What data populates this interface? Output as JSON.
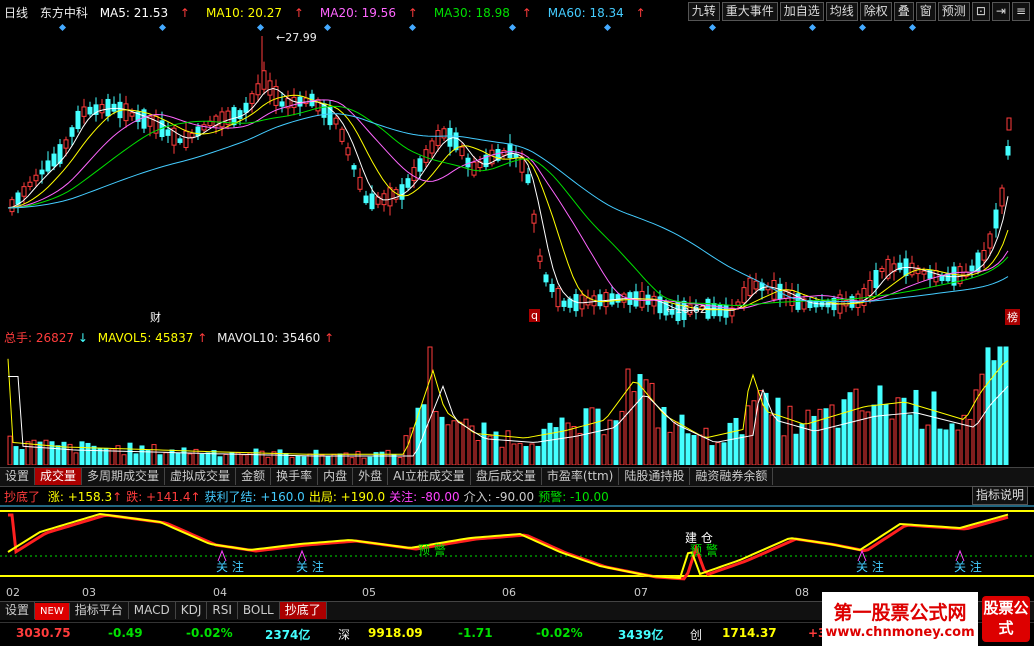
{
  "header": {
    "period": "日线",
    "stock": "东方中科",
    "ma": [
      {
        "label": "MA5: 21.53",
        "arrow": "↑",
        "color": "#ffffff"
      },
      {
        "label": "MA10: 20.27",
        "arrow": "↑",
        "color": "#ffff00"
      },
      {
        "label": "MA20: 19.56",
        "arrow": "↑",
        "color": "#ff66ff"
      },
      {
        "label": "MA30: 18.98",
        "arrow": "↑",
        "color": "#00e000"
      },
      {
        "label": "MA60: 18.34",
        "arrow": "↑",
        "color": "#44ccff"
      }
    ],
    "buttons": [
      "九转",
      "重大事件",
      "加自选",
      "均线",
      "除权",
      "叠",
      "窗",
      "预测"
    ]
  },
  "price_chart": {
    "high_label": "27.99",
    "low_label": "16.62",
    "markers": [
      "财",
      "q",
      "榜"
    ]
  },
  "volume": {
    "total_label": "总手: 26827",
    "total_arrow": "↓",
    "mavol5": "MAVOL5: 45837",
    "mavol5_arrow": "↑",
    "mavol10": "MAVOL10: 35460",
    "mavol10_arrow": "↑"
  },
  "volume_tabs": [
    "设置",
    "成交量",
    "多周期成交量",
    "虚拟成交量",
    "金额",
    "换手率",
    "内盘",
    "外盘",
    "AI立桩成交量",
    "盘后成交量",
    "市盈率(ttm)",
    "陆股通持股",
    "融资融券余额"
  ],
  "indicator": {
    "name": "抄底了",
    "params": [
      {
        "label": "涨: +158.3",
        "arrow": "↑",
        "color": "#ffff00"
      },
      {
        "label": "跌: +141.4",
        "arrow": "↑",
        "color": "#ff3c3c"
      },
      {
        "label": "获利了结: +160.0",
        "arrow": "",
        "color": "#44ccff"
      },
      {
        "label": "出局: +190.0",
        "arrow": "",
        "color": "#ffff00"
      },
      {
        "label": "关注: -80.00",
        "arrow": "",
        "color": "#ff44ff"
      },
      {
        "label": "介入: -90.00",
        "arrow": "",
        "color": "#cccccc"
      },
      {
        "label": "预警: -10.00",
        "arrow": "",
        "color": "#00e000"
      }
    ],
    "help_button": "指标说明",
    "annotations": {
      "guanzhu": "关 注",
      "yujing": "预 警",
      "jiancang": "建 仓"
    }
  },
  "x_axis": [
    "02",
    "03",
    "04",
    "05",
    "06",
    "07",
    "08"
  ],
  "bottom_tabs": [
    "设置",
    "NEW",
    "指标平台",
    "MACD",
    "KDJ",
    "RSI",
    "BOLL",
    "抄底了"
  ],
  "status": {
    "sh_index": "3030.75",
    "sh_change": "-0.49",
    "sh_pct": "-0.02%",
    "sh_amount": "2374亿",
    "sz_label": "深",
    "sz_index": "9918.09",
    "sz_change": "-1.71",
    "sz_pct": "-0.02%",
    "sz_amount": "3439亿",
    "cy_label": "创",
    "cy_index": "1714.37",
    "cy_change": "+3"
  },
  "watermark": {
    "title": "第一股票公式网",
    "url": "www.chnmoney.com",
    "badge": "股票公式"
  }
}
